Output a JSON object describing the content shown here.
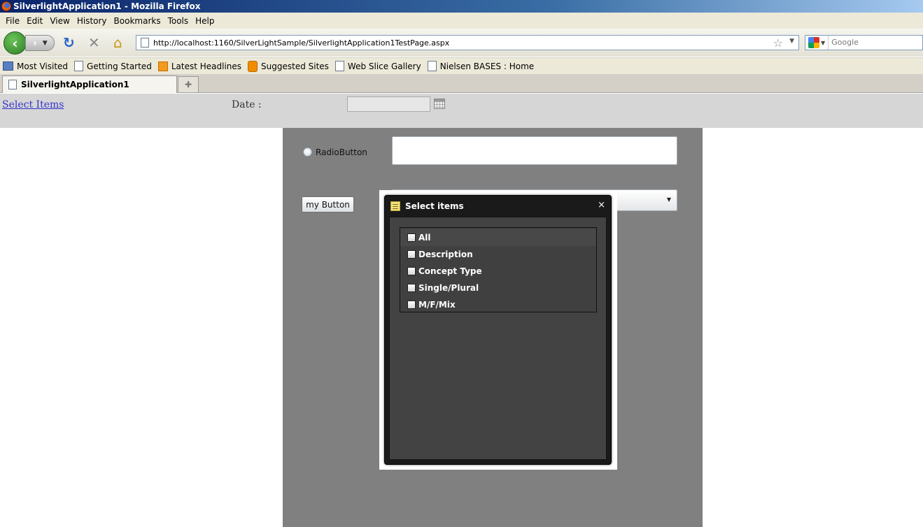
{
  "window": {
    "title": "SilverlightApplication1 - Mozilla Firefox"
  },
  "menu": [
    {
      "label": "File"
    },
    {
      "label": "Edit"
    },
    {
      "label": "View"
    },
    {
      "label": "History"
    },
    {
      "label": "Bookmarks"
    },
    {
      "label": "Tools"
    },
    {
      "label": "Help"
    }
  ],
  "navigation": {
    "url": "http://localhost:1160/SilverLightSample/SilverlightApplication1TestPage.aspx",
    "search_placeholder": "Google"
  },
  "bookmarks": [
    {
      "label": "Most Visited",
      "icon": "most-visited-icon"
    },
    {
      "label": "Getting Started",
      "icon": "page-icon"
    },
    {
      "label": "Latest Headlines",
      "icon": "rss-icon"
    },
    {
      "label": "Suggested Sites",
      "icon": "suggested-sites-icon"
    },
    {
      "label": "Web Slice Gallery",
      "icon": "page-icon"
    },
    {
      "label": "Nielsen BASES : Home",
      "icon": "page-icon"
    }
  ],
  "tabs": [
    {
      "label": "SilverlightApplication1"
    }
  ],
  "page": {
    "select_link": "Select Items",
    "date_label": "Date :",
    "date_value": ""
  },
  "silverlight": {
    "radio_label": "RadioButton",
    "button_label": "my Button",
    "textbox_value": "",
    "combo_value": ""
  },
  "popup": {
    "title": "Select items",
    "close": "×",
    "items": [
      {
        "label": "All",
        "checked": false
      },
      {
        "label": "Description",
        "checked": false
      },
      {
        "label": "Concept Type",
        "checked": false
      },
      {
        "label": "Single/Plural",
        "checked": false
      },
      {
        "label": "M/F/Mix",
        "checked": false
      }
    ]
  }
}
